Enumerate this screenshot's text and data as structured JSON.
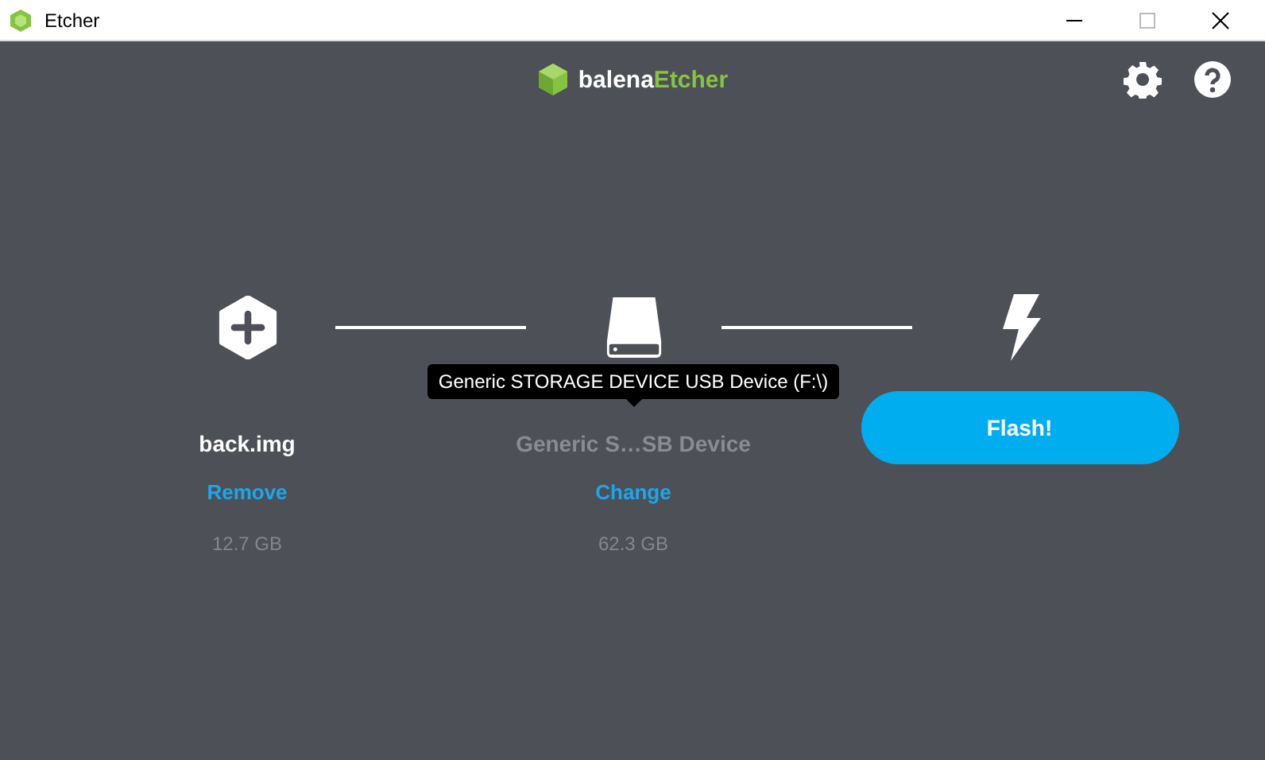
{
  "window": {
    "title": "Etcher"
  },
  "logo": {
    "brand": "balena",
    "product": "Etcher"
  },
  "steps": [
    {
      "kind": "image",
      "name": "back.img",
      "action": "Remove",
      "size": "12.7 GB"
    },
    {
      "kind": "drive",
      "name": "Generic S…SB Device",
      "action": "Change",
      "size": "62.3 GB",
      "tooltip": "Generic STORAGE DEVICE USB Device (F:\\)"
    },
    {
      "kind": "flash",
      "button": "Flash!"
    }
  ]
}
